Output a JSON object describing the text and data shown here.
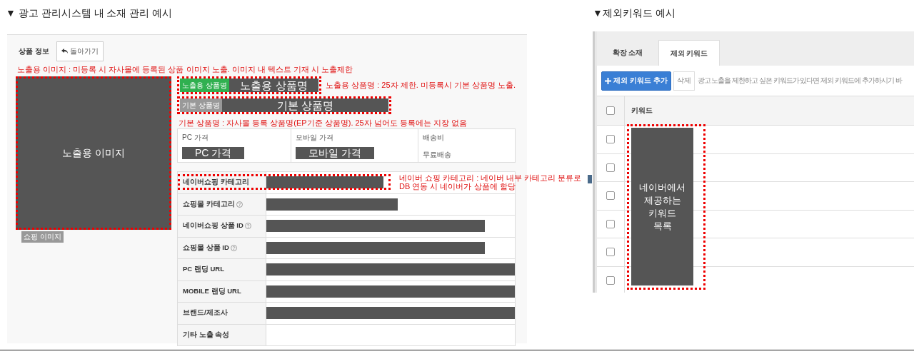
{
  "left": {
    "heading": "▼ 광고 관리시스템 내 소재 관리 예시",
    "tab_label": "상품 정보",
    "back_button": "돌아가기",
    "image_note": "노출용 이미지 : 미등록 시 자사몰에 등록된 상품 이미지 노출. 이미지 내 텍스트 기재 시 노출제한",
    "image_box": {
      "text": "노출용 이미지",
      "caption": "쇼핑 이미지"
    },
    "names": [
      {
        "kind": "exposed",
        "tag": "노출용 상품명",
        "value": "노출용 상품명",
        "note": "노출용 상품명 : 25자 제한. 미등록시 기본 상품명 노출."
      },
      {
        "kind": "basic",
        "tag": "기본 상품명",
        "value": "기본 상품명",
        "note": "기본 상품명 : 자사몰 등록 상품명(EP기준 상품명). 25자 넘어도 등록에는 지장 없음"
      }
    ],
    "prices": [
      {
        "kind": "masked",
        "label": "PC 가격",
        "value": "PC 가격"
      },
      {
        "kind": "masked",
        "label": "모바일 가격",
        "value": "모바일 가격"
      },
      {
        "kind": "plain",
        "label": "배송비",
        "value": "무료배송"
      }
    ],
    "attributes": [
      {
        "label": "네이버쇼핑 카테고리",
        "help": false,
        "redacted": true,
        "highlighted": true,
        "note_lines": [
          "네이버 쇼핑 카테고리 : 네이버 내부 카테고리 분류로",
          "DB 연동 시 네이버가 상품에 할당"
        ]
      },
      {
        "label": "쇼핑몰 카테고리",
        "help": true,
        "redacted": true,
        "highlighted": false
      },
      {
        "label": "네이버쇼핑 상품 ID",
        "help": true,
        "redacted": true,
        "highlighted": false
      },
      {
        "label": "쇼핑몰 상품 ID",
        "help": true,
        "redacted": true,
        "highlighted": false
      },
      {
        "label": "PC 랜딩 URL",
        "help": false,
        "redacted": true,
        "highlighted": false
      },
      {
        "label": "MOBILE 랜딩 URL",
        "help": false,
        "redacted": true,
        "highlighted": false
      },
      {
        "label": "브랜드/제조사",
        "help": false,
        "redacted": true,
        "highlighted": false
      },
      {
        "label": "기타 노출 속성",
        "help": false,
        "redacted": false,
        "highlighted": false
      }
    ]
  },
  "right": {
    "heading": "▼제외키워드 예시",
    "tabs": [
      {
        "label": "확장 소재",
        "selected": false
      },
      {
        "label": "제외 키워드",
        "selected": true
      }
    ],
    "add_button": "제외 키워드 추가",
    "delete_button": "삭제",
    "hint": "광고 노출을 제한하고 싶은 키워드가 있다면 제외 키워드에 추가하시기 바",
    "column": "키워드",
    "header_checked": false,
    "rows": [
      {
        "checked": false
      },
      {
        "checked": false
      },
      {
        "checked": false
      },
      {
        "checked": false
      },
      {
        "checked": false
      },
      {
        "checked": false
      }
    ],
    "overlay_lines": [
      "네이버에서",
      "제공하는",
      "키워드",
      "목록"
    ]
  }
}
